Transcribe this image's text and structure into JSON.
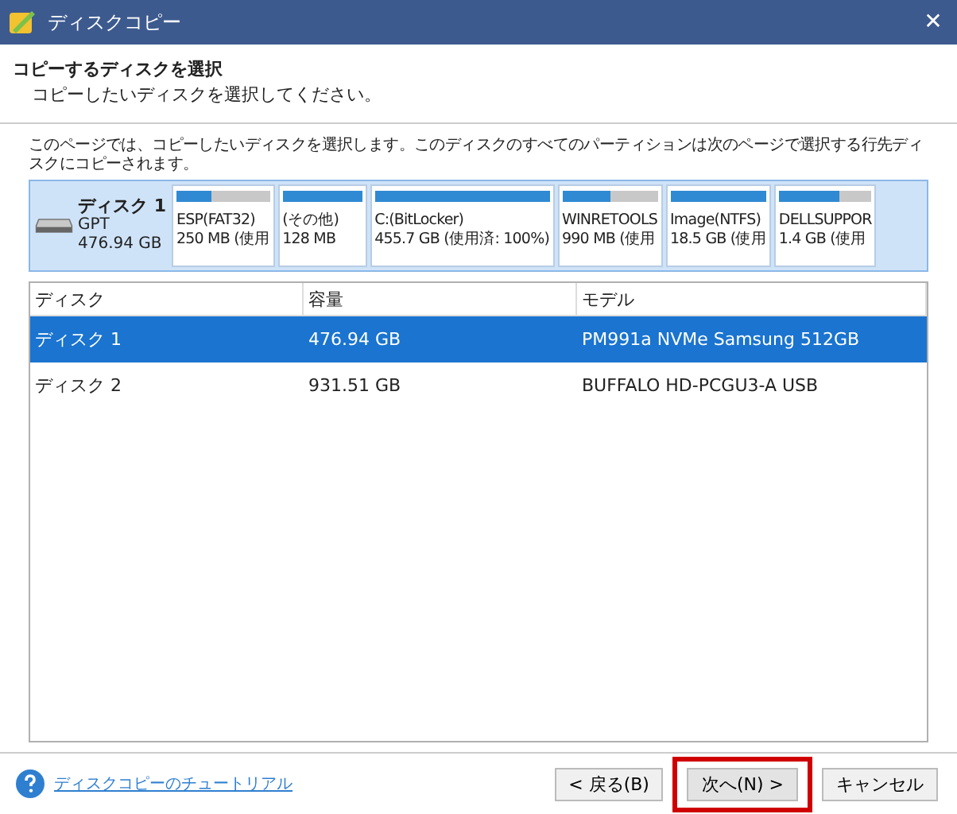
{
  "window": {
    "title": "ディスクコピー",
    "close": "✕"
  },
  "header": {
    "title": "コピーするディスクを選択",
    "subtitle": "コピーしたいディスクを選択してください。"
  },
  "description": "このページでは、コピーしたいディスクを選択します。このディスクのすべてのパーティションは次のページで選択する行先ディスクにコピーされます。",
  "disk_map": {
    "name": "ディスク 1",
    "scheme": "GPT",
    "size": "476.94 GB",
    "partitions": [
      {
        "label": "ESP(FAT32)",
        "usage": "250 MB (使用",
        "level": 0.37
      },
      {
        "label": "(その他)",
        "usage": "128 MB",
        "level": 1
      },
      {
        "label": "C:(BitLocker)",
        "usage": "455.7 GB (使用済: 100%)",
        "level": 1
      },
      {
        "label": "WINRETOOLS",
        "usage": "990 MB (使用",
        "level": 0.5
      },
      {
        "label": "Image(NTFS)",
        "usage": "18.5 GB (使用",
        "level": 1
      },
      {
        "label": "DELLSUPPOR",
        "usage": "1.4 GB (使用",
        "level": 0.65
      }
    ]
  },
  "table": {
    "columns": [
      "ディスク",
      "容量",
      "モデル"
    ],
    "rows": [
      {
        "cells": [
          "ディスク 1",
          "476.94 GB",
          "PM991a NVMe Samsung 512GB"
        ],
        "selected": true
      },
      {
        "cells": [
          "ディスク 2",
          "931.51 GB",
          "BUFFALO HD-PCGU3-A USB"
        ],
        "selected": false
      }
    ]
  },
  "footer": {
    "help_link": "ディスクコピーのチュートリアル",
    "buttons": [
      {
        "label": "< 戻る(B)",
        "highlighted": false
      },
      {
        "label": "次へ(N) >",
        "highlighted": true
      },
      {
        "label": "キャンセル",
        "highlighted": false
      }
    ]
  }
}
